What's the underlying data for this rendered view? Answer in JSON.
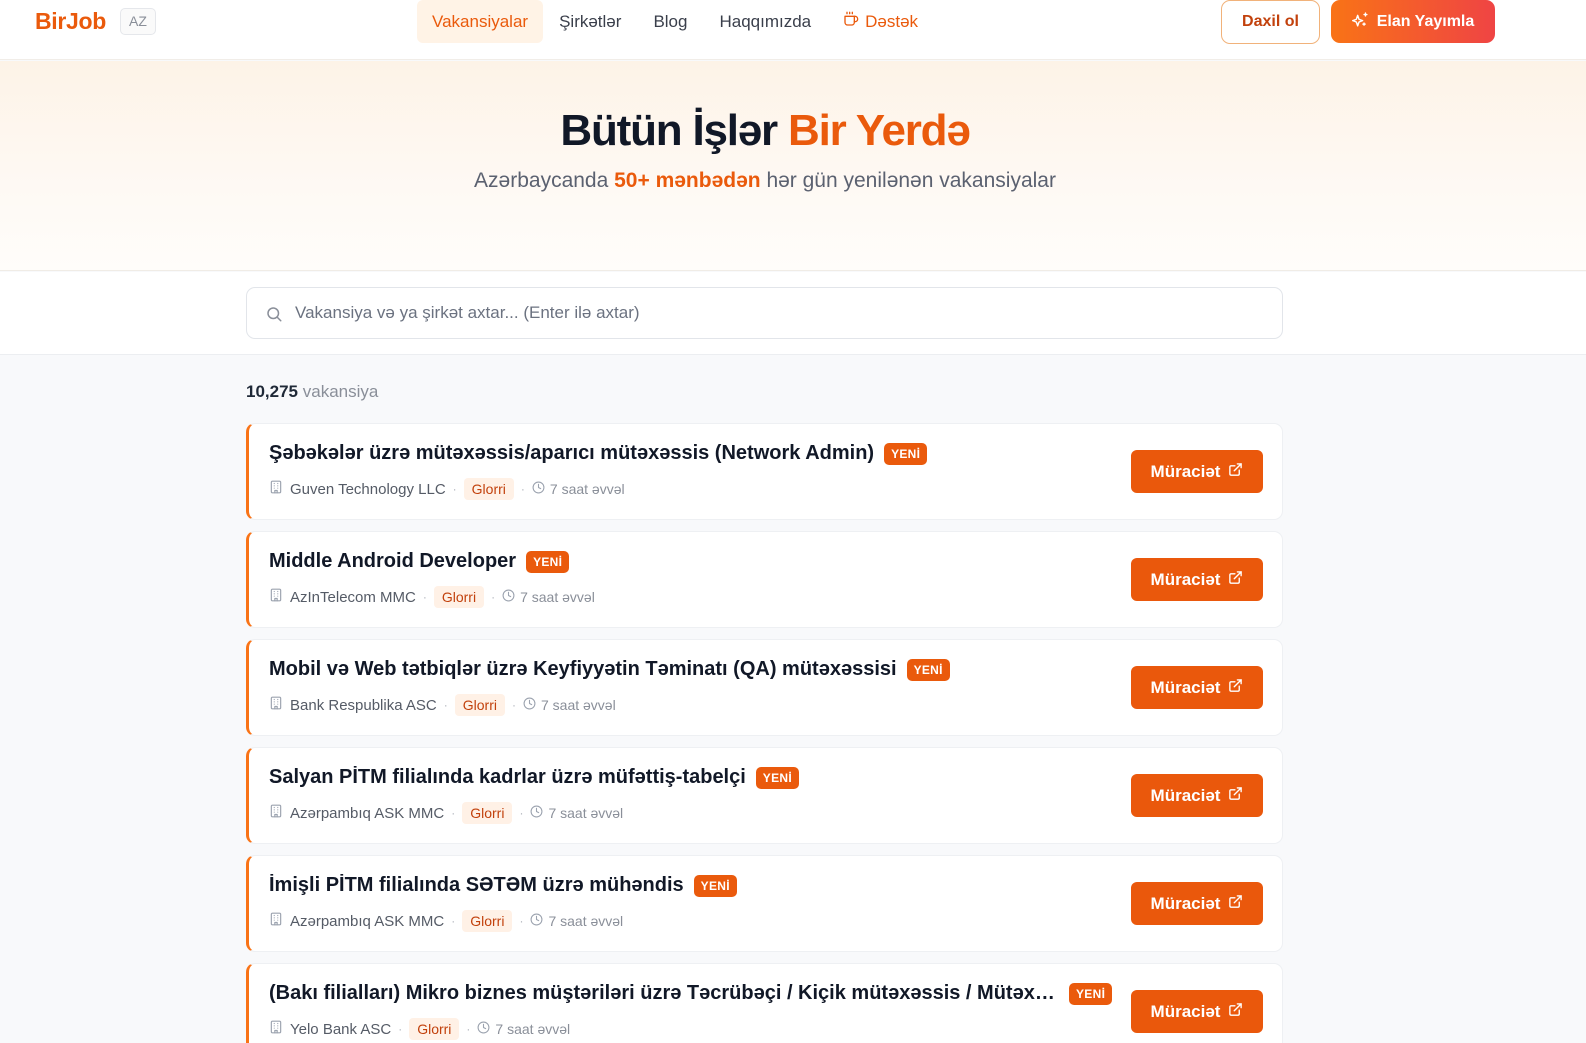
{
  "header": {
    "logo": "BirJob",
    "lang": "AZ",
    "nav": [
      {
        "label": "Vakansiyalar",
        "active": true
      },
      {
        "label": "Şirkətlər"
      },
      {
        "label": "Blog"
      },
      {
        "label": "Haqqımızda"
      },
      {
        "label": "Dəstək",
        "icon": "coffee-icon"
      }
    ],
    "login_label": "Daxil ol",
    "post_label": "Elan Yayımla"
  },
  "hero": {
    "title_main": "Bütün İşlər ",
    "title_accent": "Bir Yerdə",
    "sub_pre": "Azərbaycanda ",
    "sub_accent": "50+ mənbədən",
    "sub_post": " hər gün yenilənən vakansiyalar"
  },
  "search": {
    "placeholder": "Vakansiya və ya şirkət axtar... (Enter ilə axtar)",
    "value": ""
  },
  "results": {
    "count": "10,275",
    "count_label": "vakansiya"
  },
  "jobs": [
    {
      "title": "Şəbəkələr üzrə mütəxəssis/aparıcı mütəxəssis (Network Admin)",
      "badge": "YENİ",
      "company": "Guven Technology LLC",
      "source": "Glorri",
      "time": "7 saat əvvəl",
      "apply": "Müraciət"
    },
    {
      "title": "Middle Android Developer",
      "badge": "YENİ",
      "company": "AzInTelecom MMC",
      "source": "Glorri",
      "time": "7 saat əvvəl",
      "apply": "Müraciət"
    },
    {
      "title": "Mobil və Web tətbiqlər üzrə Keyfiyyətin Təminatı (QA) mütəxəssisi",
      "badge": "YENİ",
      "company": "Bank Respublika ASC",
      "source": "Glorri",
      "time": "7 saat əvvəl",
      "apply": "Müraciət"
    },
    {
      "title": "Salyan PİTM filialında kadrlar üzrə müfəttiş-tabelçi",
      "badge": "YENİ",
      "company": "Azərpambıq ASK MMC",
      "source": "Glorri",
      "time": "7 saat əvvəl",
      "apply": "Müraciət"
    },
    {
      "title": "İmişli PİTM filialında SƏTƏM üzrə mühəndis",
      "badge": "YENİ",
      "company": "Azərpambıq ASK MMC",
      "source": "Glorri",
      "time": "7 saat əvvəl",
      "apply": "Müraciət"
    },
    {
      "title": "(Bakı filialları) Mikro biznes müştəriləri üzrə Təcrübəçi / Kiçik mütəxəssis / Mütəxəssis",
      "badge": "YENİ",
      "company": "Yelo Bank ASC",
      "source": "Glorri",
      "time": "7 saat əvvəl",
      "apply": "Müraciət"
    }
  ],
  "colors": {
    "brand": "#ea5a0c",
    "accent_gradient_end": "#ef4444"
  }
}
